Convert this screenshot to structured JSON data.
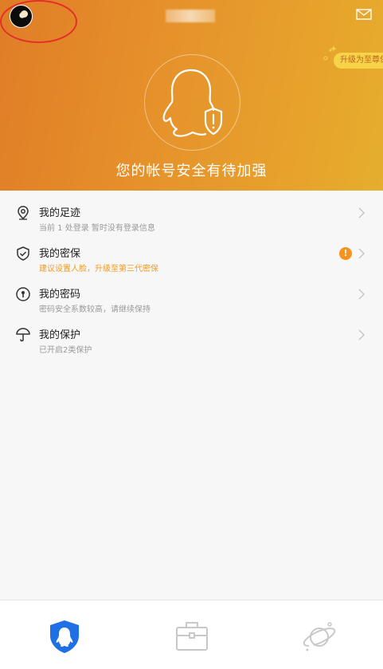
{
  "header": {
    "title": "您的帐号安全有待加强",
    "upgrade_badge": "升级为至尊保",
    "colors": {
      "gradient_start": "#e07d27",
      "gradient_end": "#e5ae2d",
      "badge_bg": "#f7d34a"
    },
    "icons": {
      "avatar": "user-avatar",
      "mail": "mail-icon",
      "hero": "qq-penguin-shield-alert-icon"
    }
  },
  "menu": {
    "items": [
      {
        "icon": "location-pin-icon",
        "title": "我的足迹",
        "subtitle": "当前 1 处登录 暂时没有登录信息",
        "alert": false
      },
      {
        "icon": "shield-check-icon",
        "title": "我的密保",
        "subtitle": "建议设置人脸，升级至第三代密保",
        "alert": true,
        "alert_symbol": "!"
      },
      {
        "icon": "key-lock-icon",
        "title": "我的密码",
        "subtitle": "密码安全系数较高，请继续保持",
        "alert": false
      },
      {
        "icon": "umbrella-icon",
        "title": "我的保护",
        "subtitle": "已开启2类保护",
        "alert": false
      }
    ]
  },
  "tabbar": {
    "tabs": [
      {
        "icon": "qq-security-shield-icon",
        "active": true
      },
      {
        "icon": "toolbox-icon",
        "active": false
      },
      {
        "icon": "planet-icon",
        "active": false
      }
    ],
    "colors": {
      "active": "#1f6fe5",
      "inactive": "#c8c8c8"
    }
  }
}
